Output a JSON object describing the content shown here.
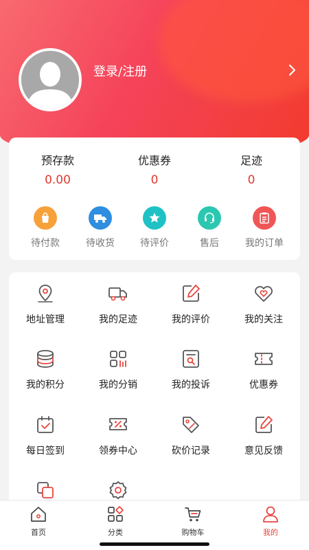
{
  "header": {
    "login_label": "登录/注册"
  },
  "stats": [
    {
      "label": "预存款",
      "value": "0.00"
    },
    {
      "label": "优惠券",
      "value": "0"
    },
    {
      "label": "足迹",
      "value": "0"
    }
  ],
  "orders": [
    {
      "label": "待付款",
      "icon": "bag-icon",
      "color": "#f7a13a"
    },
    {
      "label": "待收货",
      "icon": "truck-icon",
      "color": "#2f8ee0"
    },
    {
      "label": "待评价",
      "icon": "star-icon",
      "color": "#1fc2c4"
    },
    {
      "label": "售后",
      "icon": "headset-icon",
      "color": "#2cc7b0"
    },
    {
      "label": "我的订单",
      "icon": "clipboard-icon",
      "color": "#f05656"
    }
  ],
  "services": [
    {
      "label": "地址管理",
      "icon": "location-pin-icon"
    },
    {
      "label": "我的足迹",
      "icon": "truck-outline-icon"
    },
    {
      "label": "我的评价",
      "icon": "edit-icon"
    },
    {
      "label": "我的关注",
      "icon": "heart-icon"
    },
    {
      "label": "我的积分",
      "icon": "coins-icon"
    },
    {
      "label": "我的分销",
      "icon": "apps-icon"
    },
    {
      "label": "我的投诉",
      "icon": "complaint-icon"
    },
    {
      "label": "优惠券",
      "icon": "ticket-icon"
    },
    {
      "label": "每日签到",
      "icon": "calendar-check-icon"
    },
    {
      "label": "领券中心",
      "icon": "coupon-percent-icon"
    },
    {
      "label": "砍价记录",
      "icon": "price-tag-icon"
    },
    {
      "label": "意见反馈",
      "icon": "feedback-edit-icon"
    },
    {
      "label": "",
      "icon": "layers-icon"
    },
    {
      "label": "",
      "icon": "settings-icon"
    }
  ],
  "tabbar": [
    {
      "label": "首页",
      "icon": "home-icon"
    },
    {
      "label": "分类",
      "icon": "category-icon"
    },
    {
      "label": "购物车",
      "icon": "cart-icon"
    },
    {
      "label": "我的",
      "icon": "user-icon",
      "active": true
    }
  ],
  "colors": {
    "accent": "#e8453c",
    "icon_dark": "#555555"
  }
}
